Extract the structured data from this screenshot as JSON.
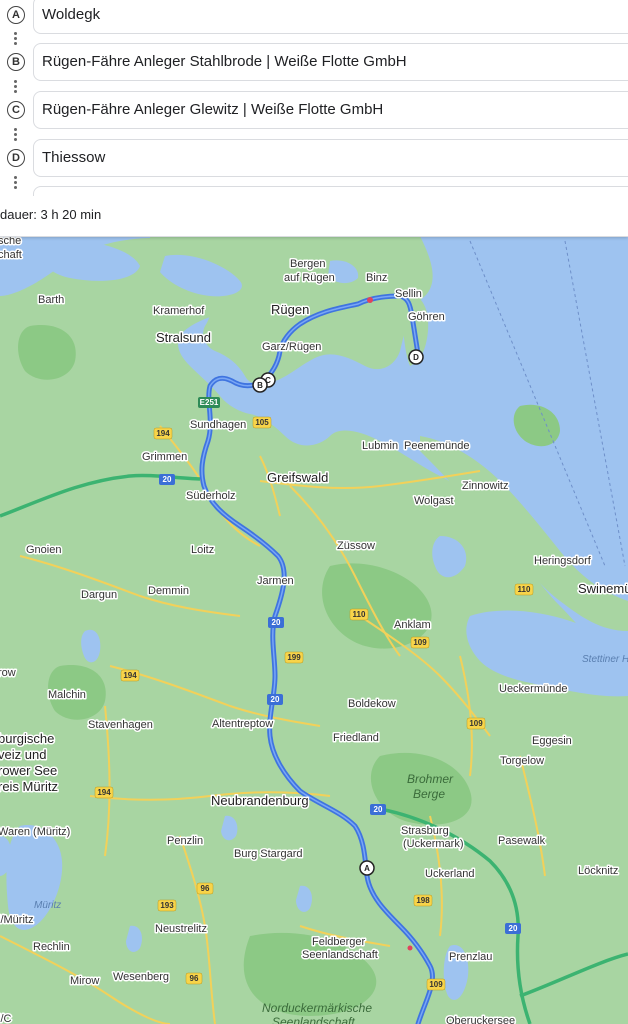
{
  "stops": [
    {
      "marker": "A",
      "value": "Woldegk"
    },
    {
      "marker": "B",
      "value": "Rügen-Fähre Anleger Stahlbrode | Weiße Flotte GmbH"
    },
    {
      "marker": "C",
      "value": "Rügen-Fähre Anleger Glewitz | Weiße Flotte GmbH"
    },
    {
      "marker": "D",
      "value": "Thiessow"
    }
  ],
  "duration": "dauer: 3 h 20 min",
  "map": {
    "colors": {
      "land": "#a8d5a2",
      "water": "#9ec3f0",
      "route": "#3f74e0",
      "motorway": "#3cb371",
      "road": "#f2d15a"
    },
    "places": {
      "bergen": "Bergen",
      "auf_ruegen": "auf Rügen",
      "binz": "Binz",
      "sellin": "Sellin",
      "goehren": "Göhren",
      "barth": "Barth",
      "kramerhof": "Kramerhof",
      "ruegen": "Rügen",
      "stralsund": "Stralsund",
      "garz": "Garz/Rügen",
      "sundhagen": "Sundhagen",
      "lubmin": "Lubmin",
      "peenemuende": "Peenemünde",
      "grimmen": "Grimmen",
      "greifswald": "Greifswald",
      "zinnowitz": "Zinnowitz",
      "suederholz": "Süderholz",
      "wolgast": "Wolgast",
      "gnoien": "Gnoien",
      "loitz": "Loitz",
      "zuessow": "Züssow",
      "heringsdorf": "Heringsdorf",
      "dargun": "Dargun",
      "demmin": "Demmin",
      "jarmen": "Jarmen",
      "swinemuende": "Swinemü",
      "anklam": "Anklam",
      "stettiner": "Stettiner H",
      "row": "row",
      "malchin": "Malchin",
      "ueckermuende": "Ueckermünde",
      "stavenhagen": "Stavenhagen",
      "boldekow": "Boldekow",
      "altentreptow": "Altentreptow",
      "eggesin": "Eggesin",
      "friedland": "Friedland",
      "burgische": "burgische",
      "weiz_und": "veiz und",
      "rower_see": "rower See",
      "reis_mueritz": "reis Müritz",
      "torgelow": "Torgelow",
      "brohmer": "Brohmer",
      "berge": "Berge",
      "neubrandenburg": "Neubrandenburg",
      "strasburg": "Strasburg",
      "uckermark": "(Uckermark)",
      "pasewalk": "Pasewalk",
      "penzlin": "Penzlin",
      "burg_stargard": "Burg Stargard",
      "waren": "Waren (Müritz)",
      "uckerland": "Uckerland",
      "loecknitz": "Löcknitz",
      "mueritz": "Müritz",
      "neustrelitz": "Neustrelitz",
      "l_mueritz": "l/Müritz",
      "feldberger": "Feldberger",
      "seenlandschaft": "Seenlandschaft",
      "prenzlau": "Prenzlau",
      "rechlin": "Rechlin",
      "mirow": "Mirow",
      "wesenberg": "Wesenberg",
      "norduckermaerkische": "Norduckermärkische",
      "seenlandschaft2": "Seenlandschaft",
      "oberuckersee": "Oberuckersee",
      "ische": "sche",
      "chaft": "chaft",
      "ldc": "l/C"
    },
    "shields": {
      "e251": "E251",
      "r194a": "194",
      "r105": "105",
      "a20a": "20",
      "r110a": "110",
      "r110b": "110",
      "r109a": "109",
      "a20b": "20",
      "r199": "199",
      "r194b": "194",
      "a20c": "20",
      "r109b": "109",
      "r194c": "194",
      "a20d": "20",
      "r198": "198",
      "r96a": "96",
      "r193": "193",
      "a20e": "20",
      "r96b": "96",
      "r109c": "109"
    },
    "markers": {
      "a": "A",
      "b": "B",
      "c": "C",
      "d": "D"
    }
  }
}
